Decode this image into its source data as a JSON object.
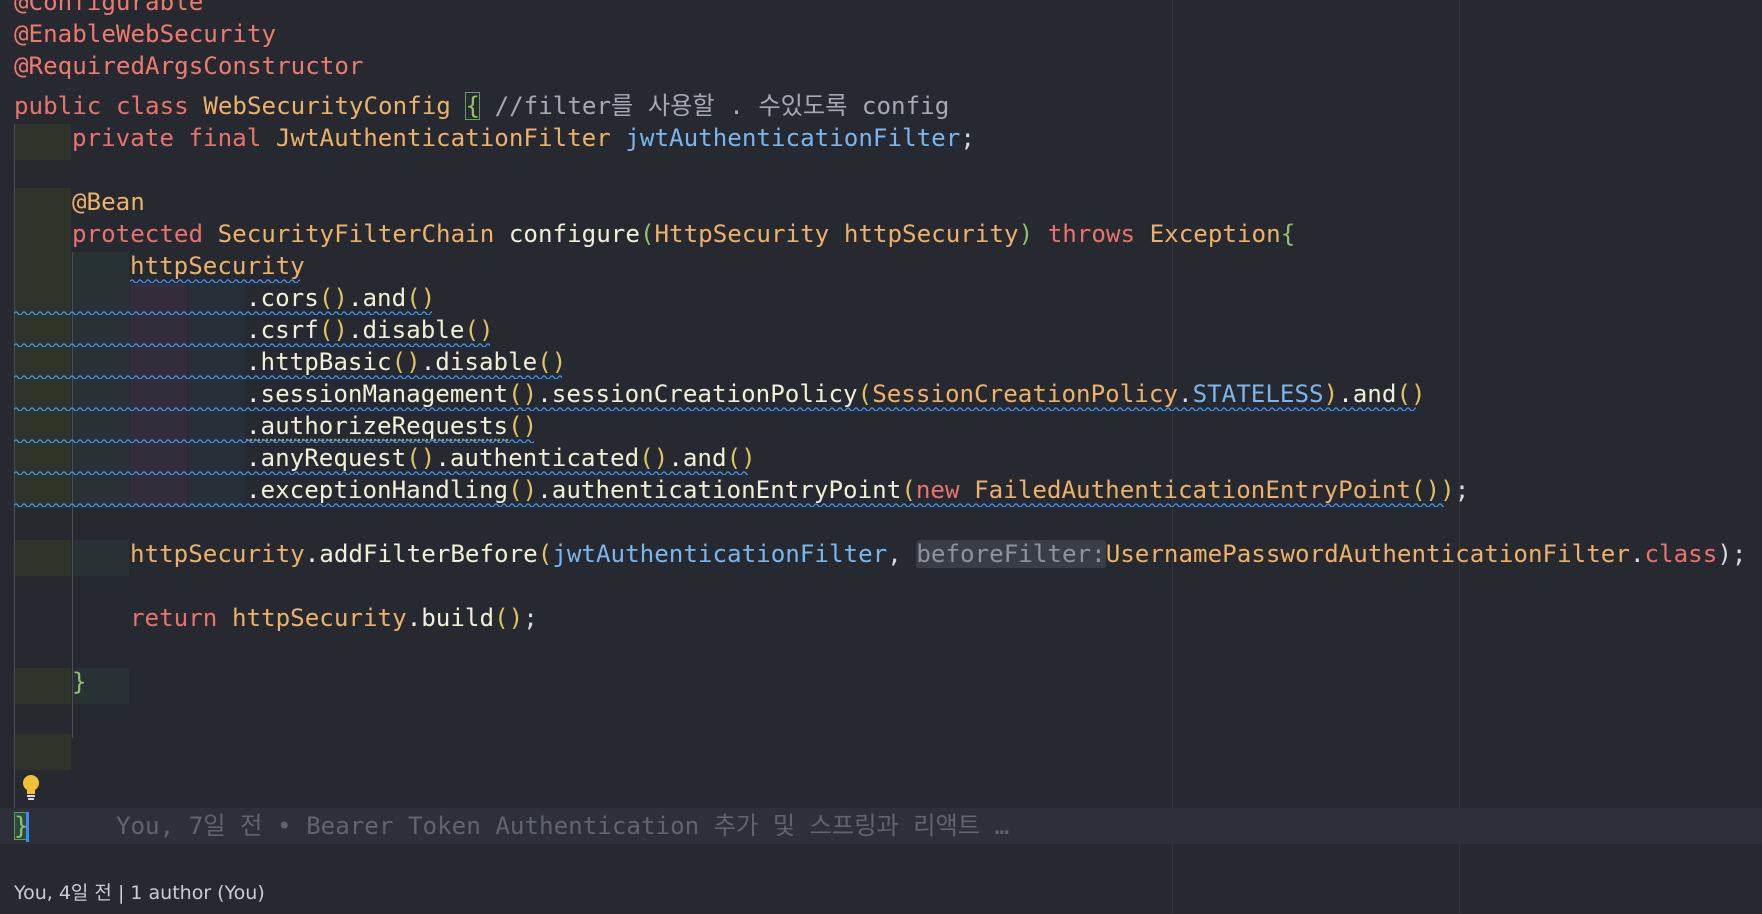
{
  "editor": {
    "language": "java",
    "lines": {
      "annotation_configurable": "@Configurable",
      "annotation_enable_web_security": "@EnableWebSecurity",
      "annotation_required_args": "@RequiredArgsConstructor",
      "class_decl": {
        "kw_public": "public",
        "kw_class": "class",
        "class_name": "WebSecurityConfig",
        "open_brace": "{",
        "comment": "//filter를 사용할 . 수있도록 config"
      },
      "field_decl": {
        "kw_private": "private",
        "kw_final": "final",
        "type": "JwtAuthenticationFilter",
        "name": "jwtAuthenticationFilter",
        "semicolon": ";"
      },
      "bean_annotation": "@Bean",
      "method_decl": {
        "kw_protected": "protected",
        "return_type": "SecurityFilterChain",
        "method_name": "configure",
        "open_paren": "(",
        "param_type": "HttpSecurity",
        "param_name": "httpSecurity",
        "close_paren": ")",
        "kw_throws": "throws",
        "exception": "Exception",
        "open_brace": "{"
      },
      "chain_start": "httpSecurity",
      "chain": {
        "cors": ".cors",
        "and": ".and",
        "csrf": ".csrf",
        "disable": ".disable",
        "http_basic": ".httpBasic",
        "session_management": ".sessionManagement",
        "session_creation_policy": ".sessionCreationPolicy",
        "policy_enum": "SessionCreationPolicy",
        "dot": ".",
        "stateless": "STATELESS",
        "authorize_requests": ".authorizeRequests",
        "any_request": ".anyRequest",
        "authenticated": ".authenticated",
        "exception_handling": ".exceptionHandling",
        "authentication_entry_point": ".authenticationEntryPoint",
        "kw_new": "new",
        "entry_point_class": "FailedAuthenticationEntryPoint",
        "parens": "()",
        "open_paren": "(",
        "close_paren": ")",
        "semicolon": ";"
      },
      "add_filter": {
        "target": "httpSecurity",
        "method": ".addFilterBefore",
        "open_paren": "(",
        "arg1": "jwtAuthenticationFilter",
        "comma": ", ",
        "param_hint": "beforeFilter:",
        "arg2_class": "UsernamePasswordAuthenticationFilter",
        "dot": ".",
        "kw_class": "class",
        "close": ");"
      },
      "return_stmt": {
        "kw_return": "return",
        "target": "httpSecurity",
        "method": ".build",
        "parens": "()",
        "semicolon": ";"
      },
      "method_close": "}",
      "class_close": "}",
      "inline_blame": "You, 7일 전 • Bearer Token Authentication 추가 및 스프링과 리액트 …"
    },
    "footer_blame": "You, 4일 전 | 1 author (You)"
  },
  "colors": {
    "background": "#262930",
    "keyword": "#e8736d",
    "class_name": "#eeb168",
    "variable": "#79b6f0",
    "method": "#f2efd8",
    "paren": "#e2c45e",
    "brace": "#8dc36b",
    "comment": "#a4a9b3",
    "squiggle": "#3b8cf0"
  },
  "icons": {
    "intention_bulb": "lightbulb-icon"
  }
}
